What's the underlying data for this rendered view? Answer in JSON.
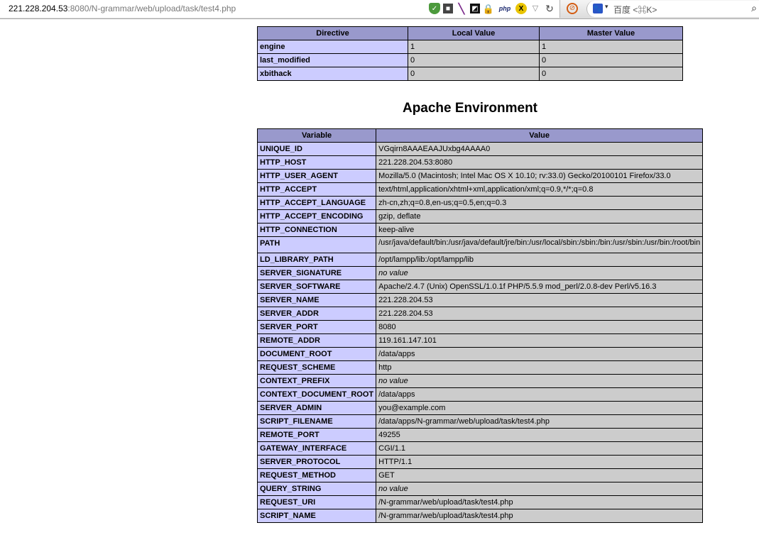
{
  "browser": {
    "url_host": "221.228.204.53",
    "url_rest": ":8080/N-grammar/web/upload/task/test4.php",
    "php_icon_text": "php",
    "search_placeholder": "百度 <⌘K>"
  },
  "directive_table": {
    "headers": [
      "Directive",
      "Local Value",
      "Master Value"
    ],
    "rows": [
      {
        "directive": "engine",
        "local": "1",
        "master": "1"
      },
      {
        "directive": "last_modified",
        "local": "0",
        "master": "0"
      },
      {
        "directive": "xbithack",
        "local": "0",
        "master": "0"
      }
    ]
  },
  "apache_environment": {
    "title": "Apache Environment",
    "headers": [
      "Variable",
      "Value"
    ],
    "rows": [
      {
        "variable": "UNIQUE_ID",
        "value": "VGqirn8AAAEAAJUxbg4AAAA0"
      },
      {
        "variable": "HTTP_HOST",
        "value": "221.228.204.53:8080"
      },
      {
        "variable": "HTTP_USER_AGENT",
        "value": "Mozilla/5.0 (Macintosh; Intel Mac OS X 10.10; rv:33.0) Gecko/20100101 Firefox/33.0"
      },
      {
        "variable": "HTTP_ACCEPT",
        "value": "text/html,application/xhtml+xml,application/xml;q=0.9,*/*;q=0.8"
      },
      {
        "variable": "HTTP_ACCEPT_LANGUAGE",
        "value": "zh-cn,zh;q=0.8,en-us;q=0.5,en;q=0.3"
      },
      {
        "variable": "HTTP_ACCEPT_ENCODING",
        "value": "gzip, deflate"
      },
      {
        "variable": "HTTP_CONNECTION",
        "value": "keep-alive"
      },
      {
        "variable": "PATH",
        "value": "/usr/java/default/bin:/usr/java/default/jre/bin:/usr/local/sbin:/sbin:/bin:/usr/sbin:/usr/bin:/root/bin"
      },
      {
        "variable": "LD_LIBRARY_PATH",
        "value": "/opt/lampp/lib:/opt/lampp/lib"
      },
      {
        "variable": "SERVER_SIGNATURE",
        "value": "no value"
      },
      {
        "variable": "SERVER_SOFTWARE",
        "value": "Apache/2.4.7 (Unix) OpenSSL/1.0.1f PHP/5.5.9 mod_perl/2.0.8-dev Perl/v5.16.3"
      },
      {
        "variable": "SERVER_NAME",
        "value": "221.228.204.53"
      },
      {
        "variable": "SERVER_ADDR",
        "value": "221.228.204.53"
      },
      {
        "variable": "SERVER_PORT",
        "value": "8080"
      },
      {
        "variable": "REMOTE_ADDR",
        "value": "119.161.147.101"
      },
      {
        "variable": "DOCUMENT_ROOT",
        "value": "/data/apps"
      },
      {
        "variable": "REQUEST_SCHEME",
        "value": "http"
      },
      {
        "variable": "CONTEXT_PREFIX",
        "value": "no value"
      },
      {
        "variable": "CONTEXT_DOCUMENT_ROOT",
        "value": "/data/apps"
      },
      {
        "variable": "SERVER_ADMIN",
        "value": "you@example.com"
      },
      {
        "variable": "SCRIPT_FILENAME",
        "value": "/data/apps/N-grammar/web/upload/task/test4.php"
      },
      {
        "variable": "REMOTE_PORT",
        "value": "49255"
      },
      {
        "variable": "GATEWAY_INTERFACE",
        "value": "CGI/1.1"
      },
      {
        "variable": "SERVER_PROTOCOL",
        "value": "HTTP/1.1"
      },
      {
        "variable": "REQUEST_METHOD",
        "value": "GET"
      },
      {
        "variable": "QUERY_STRING",
        "value": "no value"
      },
      {
        "variable": "REQUEST_URI",
        "value": "/N-grammar/web/upload/task/test4.php"
      },
      {
        "variable": "SCRIPT_NAME",
        "value": "/N-grammar/web/upload/task/test4.php"
      }
    ]
  },
  "colors": {
    "header_bg": "#9999cc",
    "key_bg": "#ccccff",
    "value_bg": "#cccccc"
  }
}
